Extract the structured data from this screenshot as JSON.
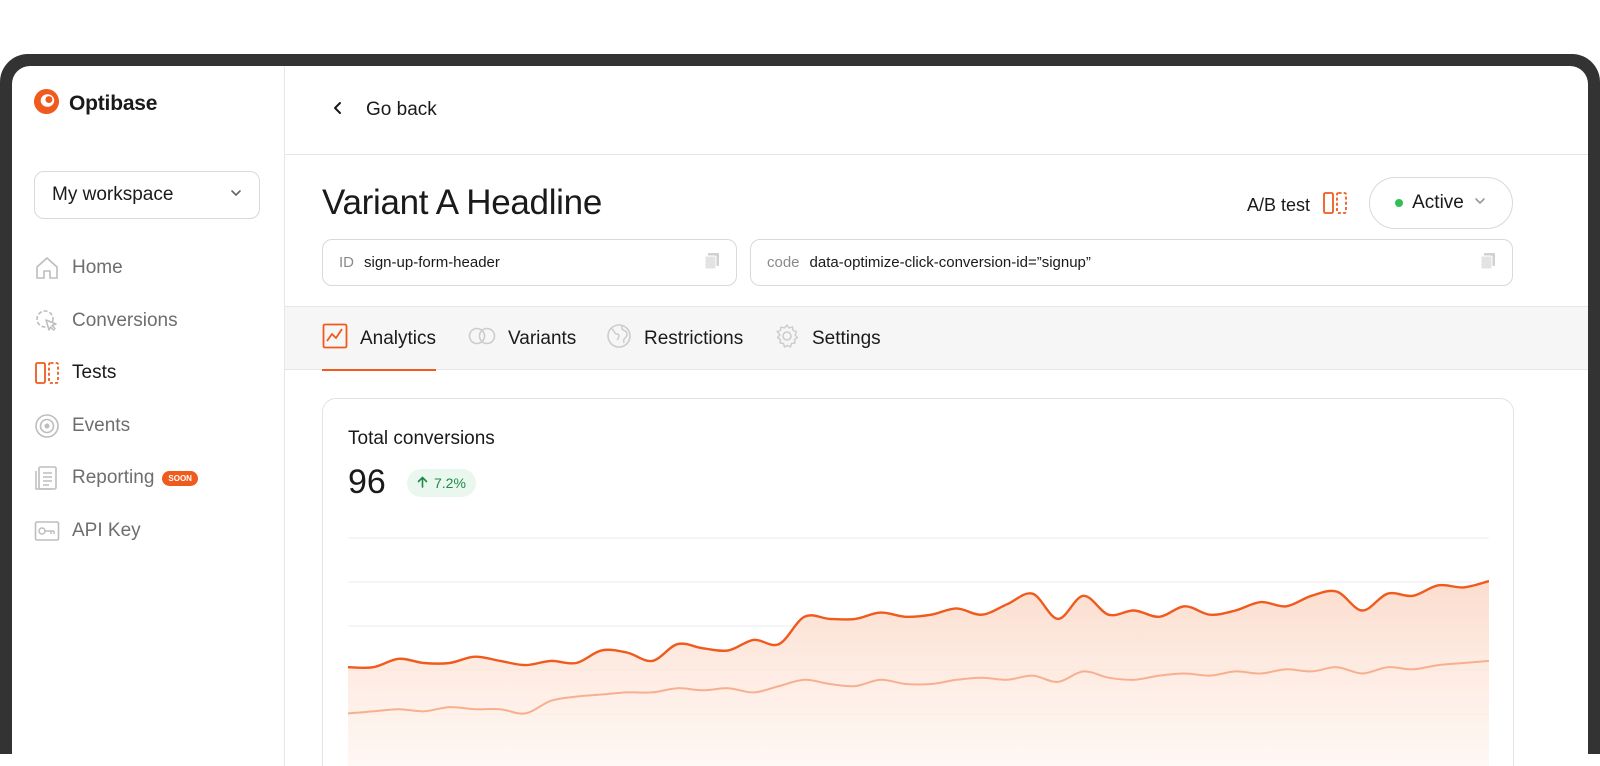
{
  "brand": {
    "name": "Optibase",
    "logo_icon": "optibase-logo-icon",
    "accent": "#f05a1c"
  },
  "workspace": {
    "label": "My workspace"
  },
  "sidebar": {
    "items": [
      {
        "label": "Home",
        "icon": "home-icon",
        "active": false
      },
      {
        "label": "Conversions",
        "icon": "cursor-click-icon",
        "active": false
      },
      {
        "label": "Tests",
        "icon": "split-test-icon",
        "active": true
      },
      {
        "label": "Events",
        "icon": "target-icon",
        "active": false
      },
      {
        "label": "Reporting",
        "icon": "report-icon",
        "active": false,
        "badge": "SOON"
      },
      {
        "label": "API Key",
        "icon": "key-icon",
        "active": false
      }
    ]
  },
  "topbar": {
    "back_label": "Go back"
  },
  "header": {
    "title": "Variant A Headline",
    "test_type": "A/B test",
    "status": "Active",
    "status_color": "#2fbf55",
    "id_label": "ID",
    "id_value": "sign-up-form-header",
    "code_label": "code",
    "code_value": "data-optimize-click-conversion-id=”signup”"
  },
  "tabs": [
    {
      "label": "Analytics",
      "icon": "line-chart-icon",
      "active": true
    },
    {
      "label": "Variants",
      "icon": "toggle-icon",
      "active": false
    },
    {
      "label": "Restrictions",
      "icon": "globe-icon",
      "active": false
    },
    {
      "label": "Settings",
      "icon": "gear-icon",
      "active": false
    }
  ],
  "analytics": {
    "card_title": "Total conversions",
    "total": "96",
    "delta": "7.2%",
    "delta_direction": "up"
  },
  "chart_data": {
    "type": "area",
    "title": "",
    "xlabel": "",
    "ylabel": "",
    "grid": true,
    "ylim": [
      0,
      100
    ],
    "series": [
      {
        "color": "#f05a1c",
        "values": [
          28,
          28,
          32,
          30,
          30,
          33,
          31,
          29,
          31,
          30,
          36,
          35,
          31,
          39,
          37,
          36,
          41,
          39,
          52,
          51,
          51,
          54,
          52,
          53,
          56,
          53,
          58,
          63,
          51,
          62,
          53,
          55,
          52,
          57,
          53,
          55,
          59,
          57,
          62,
          64,
          55,
          63,
          62,
          67,
          66,
          69
        ]
      },
      {
        "color": "#f7b08f",
        "values": [
          6,
          7,
          8,
          7,
          9,
          8,
          8,
          6,
          12,
          14,
          15,
          16,
          16,
          18,
          17,
          18,
          16,
          19,
          22,
          20,
          19,
          22,
          20,
          20,
          22,
          23,
          22,
          24,
          21,
          26,
          23,
          22,
          24,
          25,
          24,
          26,
          25,
          27,
          26,
          28,
          25,
          28,
          27,
          29,
          30,
          31
        ]
      }
    ]
  }
}
